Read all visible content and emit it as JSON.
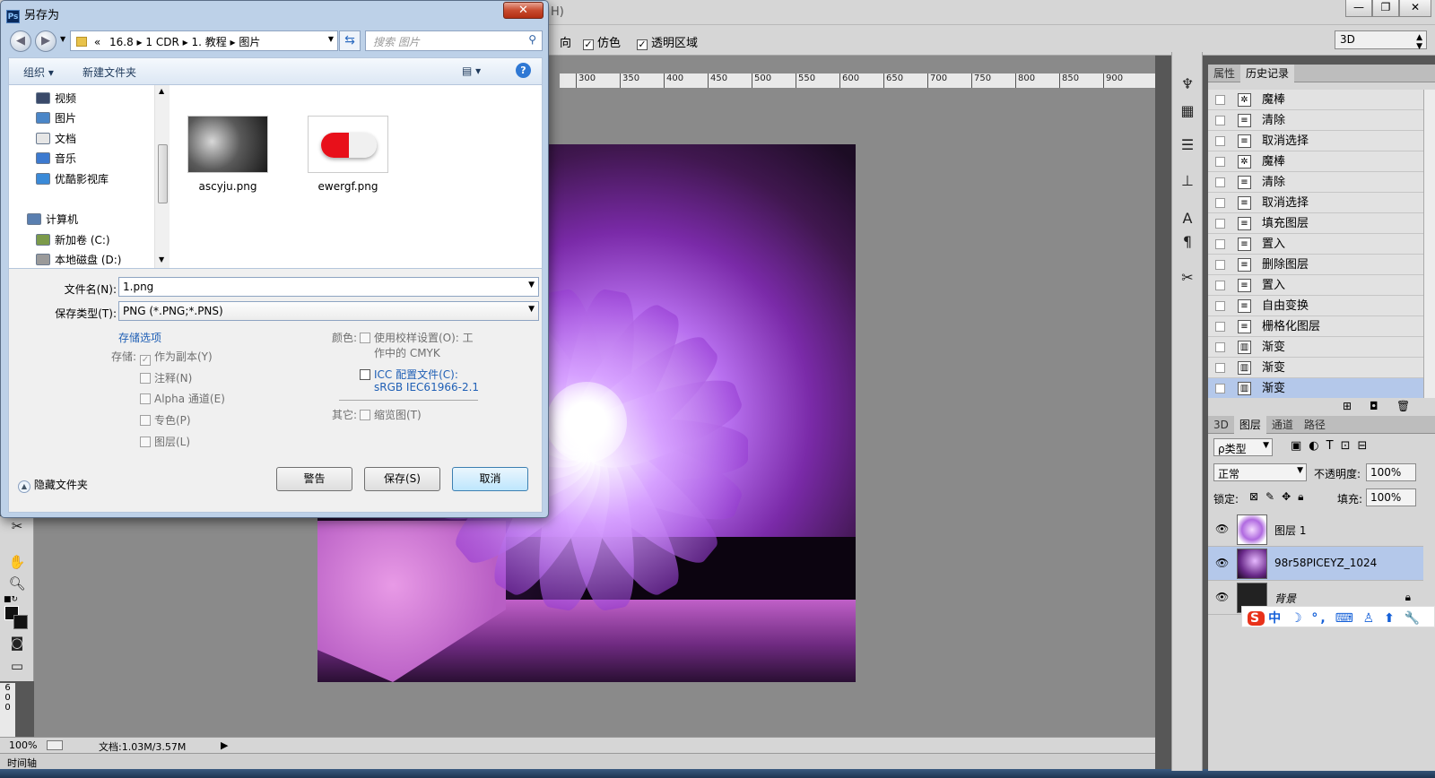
{
  "photoshop": {
    "title_fragment": "H)",
    "window_buttons": {
      "minimize": "—",
      "restore": "❐",
      "close": "✕"
    },
    "options": {
      "dither_label": "仿色",
      "transparency_label": "透明区域",
      "direction_fragment": "向",
      "workspace": "3D"
    },
    "ruler_ticks": [
      "300",
      "350",
      "400",
      "450",
      "500",
      "550",
      "600",
      "650",
      "700",
      "750",
      "800",
      "850",
      "900"
    ],
    "ruler_left": [
      "6",
      "0",
      "0"
    ],
    "status": {
      "zoom": "100%",
      "doc_info": "文档:1.03M/3.57M"
    },
    "timeline_label": "时间轴",
    "history": {
      "tabs": [
        "属性",
        "历史记录"
      ],
      "items": [
        {
          "label": "魔棒",
          "icon": "magic-wand-icon"
        },
        {
          "label": "清除",
          "icon": "document-icon"
        },
        {
          "label": "取消选择",
          "icon": "document-icon"
        },
        {
          "label": "魔棒",
          "icon": "magic-wand-icon"
        },
        {
          "label": "清除",
          "icon": "document-icon"
        },
        {
          "label": "取消选择",
          "icon": "document-icon"
        },
        {
          "label": "填充图层",
          "icon": "document-icon"
        },
        {
          "label": "置入",
          "icon": "document-icon"
        },
        {
          "label": "删除图层",
          "icon": "document-icon"
        },
        {
          "label": "置入",
          "icon": "document-icon"
        },
        {
          "label": "自由变换",
          "icon": "document-icon"
        },
        {
          "label": "栅格化图层",
          "icon": "document-icon"
        },
        {
          "label": "渐变",
          "icon": "gradient-icon"
        },
        {
          "label": "渐变",
          "icon": "gradient-icon"
        },
        {
          "label": "渐变",
          "icon": "gradient-icon"
        }
      ]
    },
    "layers": {
      "tabs": [
        "3D",
        "图层",
        "通道",
        "路径"
      ],
      "filter_type": "ρ类型",
      "blend_mode": "正常",
      "opacity_label": "不透明度:",
      "opacity": "100%",
      "lock_label": "锁定:",
      "fill_label": "填充:",
      "fill": "100%",
      "items": [
        {
          "name": "图层 1"
        },
        {
          "name": "98r58PICEYZ_1024"
        },
        {
          "name": "背景"
        }
      ]
    },
    "ime": {
      "logo": "S",
      "text": "中 ☽ °, ⌨ ♙ ⬆ 🔧"
    }
  },
  "dialog": {
    "title": "另存为",
    "app_badge": "Ps",
    "address": [
      "«",
      "16.8",
      "1 CDR",
      "1. 教程",
      "图片"
    ],
    "search_placeholder": "搜索 图片",
    "toolbar": {
      "organize": "组织 ▾",
      "new_folder": "新建文件夹"
    },
    "tree": [
      {
        "label": "视频",
        "color": "#3a4a6a"
      },
      {
        "label": "图片",
        "color": "#4a86c8"
      },
      {
        "label": "文档",
        "color": "#e6e6e6"
      },
      {
        "label": "音乐",
        "color": "#3c7ad0"
      },
      {
        "label": "优酷影视库",
        "color": "#3a8ad8"
      },
      {
        "label": "计算机",
        "color": "#5a7fb0"
      },
      {
        "label": "新加卷 (C:)",
        "color": "#7b9a4a"
      },
      {
        "label": "本地磁盘 (D:)",
        "color": "#9a9a9a"
      }
    ],
    "files": [
      {
        "name": "ascyju.png"
      },
      {
        "name": "ewergf.png"
      }
    ],
    "filename_label": "文件名(N):",
    "filename": "1.png",
    "filetype_label": "保存类型(T):",
    "filetype": "PNG (*.PNG;*.PNS)",
    "options": {
      "storage_options_link": "存储选项",
      "save_label": "存储:",
      "as_copy": "作为副本(Y)",
      "notes": "注释(N)",
      "alpha": "Alpha 通道(E)",
      "spot": "专色(P)",
      "layers": "图层(L)",
      "color_label": "颜色:",
      "proof_setup_line1": "使用校样设置(O): 工",
      "proof_setup_line2": "作中的 CMYK",
      "icc_line1": "ICC 配置文件(C):",
      "icc_line2": "sRGB IEC61966-2.1",
      "other_label": "其它:",
      "thumbnail": "缩览图(T)"
    },
    "hide_folders": "隐藏文件夹",
    "buttons": {
      "warning": "警告",
      "save": "保存(S)",
      "cancel": "取消"
    },
    "close_glyph": "✕"
  }
}
